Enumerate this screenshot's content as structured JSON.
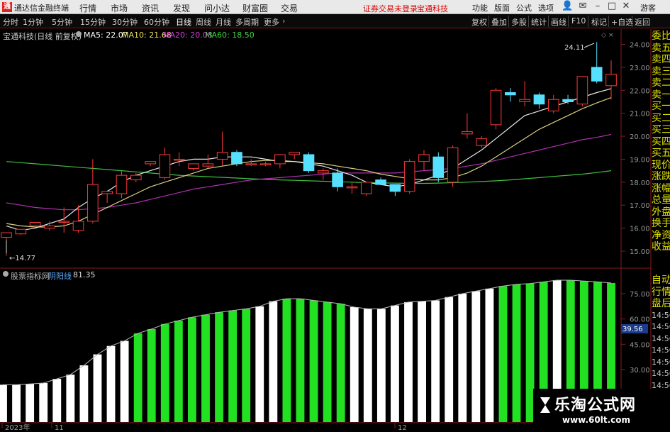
{
  "titlebar": {
    "app_title": "通达信金融终端",
    "menu": [
      "行情",
      "市场",
      "资讯",
      "发现",
      "问小达",
      "财富圈",
      "交易"
    ],
    "notice": "证券交易未登录",
    "stock_name": "宝通科技",
    "right_menu": [
      "功能",
      "版面",
      "公式",
      "选项"
    ],
    "guest": "游客"
  },
  "toolbar": {
    "period_tabs": [
      "分时",
      "1分钟",
      "5分钟",
      "15分钟",
      "30分钟",
      "60分钟",
      "日线",
      "周线",
      "月线",
      "多周期",
      "更多"
    ],
    "active_tab": "日线",
    "right_buttons": [
      "复权",
      "叠加",
      "多股",
      "统计",
      "画线",
      "F10",
      "标记",
      "+自选",
      "返回"
    ]
  },
  "main_chart": {
    "title": "宝通科技(日线 前复权)",
    "ma_labels": [
      {
        "text": "MA5: 22.07",
        "color": "#ffffff"
      },
      {
        "text": "MA10: 21.68",
        "color": "#e8e05a"
      },
      {
        "text": "MA20: 20.08",
        "color": "#d040d0"
      },
      {
        "text": "MA60: 18.50",
        "color": "#40d040"
      }
    ],
    "high_label": "24.11",
    "low_label": "14.77"
  },
  "indicator": {
    "source_label": "股票指标网",
    "name": "阴阳线",
    "value": "81.35",
    "current_tag": "39.56"
  },
  "x_axis": [
    "2023年",
    "11",
    "12"
  ],
  "right_panel_1": [
    "委比",
    "卖五",
    "卖四",
    "卖三",
    "卖二",
    "卖一",
    "买一",
    "买二",
    "买三",
    "买四",
    "买五",
    "现价",
    "涨跌",
    "涨幅",
    "总量",
    "外盘",
    "换手",
    "净资",
    "收益"
  ],
  "right_panel_2": [
    "自动",
    "行情",
    "盘后",
    "14:56",
    "14:56",
    "14:56",
    "14:56",
    "14:56",
    "14:56",
    "14:56",
    "14:56"
  ],
  "watermark": {
    "line1": "乐淘公式网",
    "line2": "www.60lt.com"
  },
  "chart_data": [
    {
      "type": "candlestick",
      "title": "宝通科技(日线 前复权)",
      "y_ticks": [
        24,
        23,
        22,
        21,
        20,
        19,
        18,
        17,
        16,
        15
      ],
      "ylim": [
        14.5,
        24.5
      ],
      "candles": [
        [
          15.6,
          15.8,
          15.7,
          14.8
        ],
        [
          15.75,
          15.95,
          15.75,
          15.7
        ],
        [
          16.1,
          16.25,
          16.1,
          16.05
        ],
        [
          16.0,
          16.1,
          16.3,
          15.9
        ],
        [
          16.3,
          16.3,
          16.9,
          15.8
        ],
        [
          15.9,
          16.3,
          17.0,
          15.8
        ],
        [
          16.3,
          17.9,
          19.0,
          16.2
        ],
        [
          17.5,
          17.6,
          17.6,
          17.1
        ],
        [
          17.5,
          18.3,
          18.5,
          17.3
        ],
        [
          18.1,
          18.3,
          18.4,
          18.0
        ],
        [
          18.8,
          18.9,
          18.9,
          18.7
        ],
        [
          18.2,
          19.2,
          19.5,
          18.1
        ],
        [
          19.0,
          19.0,
          19.3,
          18.7
        ],
        [
          18.6,
          18.8,
          18.8,
          18.5
        ],
        [
          18.7,
          18.8,
          19.2,
          18.6
        ],
        [
          19.0,
          19.3,
          20.2,
          18.7
        ],
        [
          19.3,
          18.8,
          19.4,
          18.7
        ],
        [
          18.8,
          18.8,
          19.0,
          18.7
        ],
        [
          18.8,
          18.8,
          18.9,
          18.7
        ],
        [
          18.8,
          19.2,
          19.2,
          18.6
        ],
        [
          19.2,
          19.3,
          19.3,
          19.0
        ],
        [
          19.2,
          18.5,
          19.3,
          18.4
        ],
        [
          18.4,
          18.5,
          18.6,
          18.1
        ],
        [
          18.4,
          17.8,
          18.6,
          17.6
        ],
        [
          17.8,
          17.8,
          18.0,
          17.5
        ],
        [
          17.5,
          18.0,
          18.0,
          17.4
        ],
        [
          18.1,
          17.9,
          18.2,
          17.9
        ],
        [
          17.9,
          17.6,
          17.9,
          17.4
        ],
        [
          17.6,
          18.9,
          19.0,
          17.5
        ],
        [
          18.9,
          19.2,
          19.4,
          18.5
        ],
        [
          19.1,
          18.2,
          19.3,
          18.0
        ],
        [
          18.0,
          19.5,
          19.6,
          17.8
        ],
        [
          20.1,
          20.2,
          21.0,
          19.9
        ],
        [
          19.6,
          19.9,
          20.0,
          19.5
        ],
        [
          20.5,
          22.0,
          22.1,
          20.3
        ],
        [
          21.9,
          21.8,
          22.1,
          21.5
        ],
        [
          21.5,
          21.6,
          22.4,
          21.3
        ],
        [
          21.8,
          21.4,
          21.9,
          21.2
        ],
        [
          21.1,
          21.6,
          21.8,
          21.0
        ],
        [
          21.6,
          21.5,
          21.8,
          21.4
        ],
        [
          21.4,
          22.6,
          22.6,
          21.3
        ],
        [
          23.0,
          22.4,
          24.1,
          22.3
        ],
        [
          22.2,
          22.7,
          23.3,
          21.6
        ]
      ],
      "ma5": [
        16.1,
        15.9,
        16.0,
        16.2,
        16.4,
        16.9,
        17.3,
        17.6,
        18.0,
        18.3,
        18.5,
        18.7,
        18.9,
        19.0,
        19.0,
        19.1,
        19.1,
        19.1,
        19.0,
        18.9,
        18.9,
        18.8,
        18.7,
        18.5,
        18.3,
        18.0,
        17.9,
        17.8,
        17.9,
        18.1,
        18.3,
        18.6,
        19.0,
        19.4,
        19.9,
        20.4,
        20.9,
        21.1,
        21.3,
        21.5,
        21.7,
        21.9,
        22.07
      ],
      "ma10": [
        16.2,
        16.1,
        16.05,
        16.05,
        16.1,
        16.3,
        16.6,
        16.9,
        17.2,
        17.5,
        17.8,
        18.0,
        18.2,
        18.4,
        18.6,
        18.7,
        18.8,
        18.9,
        18.95,
        18.95,
        18.9,
        18.85,
        18.8,
        18.7,
        18.6,
        18.5,
        18.35,
        18.25,
        18.15,
        18.1,
        18.1,
        18.2,
        18.4,
        18.7,
        19.1,
        19.5,
        19.9,
        20.3,
        20.6,
        20.9,
        21.2,
        21.45,
        21.68
      ],
      "ma20": [
        17.1,
        17.0,
        16.9,
        16.85,
        16.8,
        16.8,
        16.85,
        16.9,
        17.0,
        17.1,
        17.25,
        17.4,
        17.55,
        17.7,
        17.8,
        17.9,
        18.0,
        18.1,
        18.15,
        18.2,
        18.25,
        18.3,
        18.35,
        18.4,
        18.4,
        18.4,
        18.4,
        18.4,
        18.45,
        18.5,
        18.55,
        18.6,
        18.7,
        18.8,
        18.95,
        19.1,
        19.25,
        19.4,
        19.55,
        19.7,
        19.85,
        19.95,
        20.08
      ],
      "ma60": [
        18.9,
        18.85,
        18.8,
        18.75,
        18.7,
        18.65,
        18.6,
        18.55,
        18.5,
        18.45,
        18.4,
        18.35,
        18.3,
        18.27,
        18.24,
        18.21,
        18.18,
        18.15,
        18.12,
        18.1,
        18.08,
        18.06,
        18.04,
        18.02,
        18.0,
        17.98,
        17.97,
        17.96,
        17.95,
        17.95,
        17.96,
        17.98,
        18.0,
        18.03,
        18.06,
        18.1,
        18.15,
        18.2,
        18.25,
        18.3,
        18.35,
        18.42,
        18.5
      ]
    },
    {
      "type": "bar",
      "title": "阴阳线",
      "y_ticks": [
        75,
        60,
        45,
        30
      ],
      "ylim": [
        20,
        85
      ],
      "values": [
        21,
        21,
        21.5,
        22,
        24.5,
        27,
        32.5,
        39,
        44,
        47,
        51.5,
        54,
        57,
        59,
        61,
        62.5,
        64,
        65,
        66,
        67.5,
        70.5,
        72,
        72,
        71,
        70,
        69,
        67,
        66,
        66,
        68,
        70,
        70.5,
        71,
        73,
        75,
        76.5,
        78,
        79.5,
        80.5,
        81,
        82,
        83,
        83,
        82.5,
        82,
        81.35
      ],
      "colors": [
        "white",
        "white",
        "white",
        "white",
        "white",
        "white",
        "white",
        "white",
        "white",
        "white",
        "green",
        "green",
        "green",
        "green",
        "green",
        "green",
        "green",
        "green",
        "green",
        "white",
        "white",
        "green",
        "green",
        "green",
        "green",
        "green",
        "white",
        "white",
        "white",
        "white",
        "white",
        "white",
        "white",
        "white",
        "white",
        "white",
        "white",
        "green",
        "green",
        "green",
        "green",
        "white",
        "green",
        "green",
        "green",
        "green"
      ]
    }
  ]
}
